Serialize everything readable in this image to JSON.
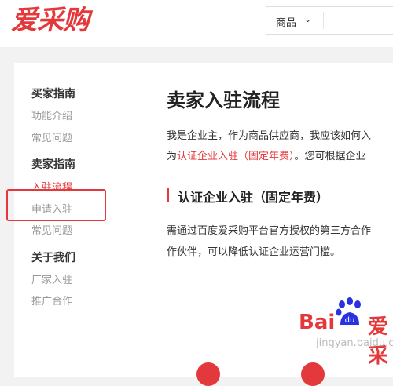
{
  "header": {
    "logo": "爱采购",
    "search_category": "商品",
    "chevron_glyph": "⌄"
  },
  "sidebar": {
    "groups": [
      {
        "title": "买家指南",
        "items": [
          "功能介绍",
          "常见问题"
        ]
      },
      {
        "title": "卖家指南",
        "items": [
          "入驻流程",
          "申请入驻",
          "常见问题"
        ]
      },
      {
        "title": "关于我们",
        "items": [
          "厂家入驻",
          "推广合作"
        ]
      }
    ],
    "active_item": "入驻流程"
  },
  "main": {
    "title": "卖家入驻流程",
    "intro_line1": "我是企业主，作为商品供应商，我应该如何入",
    "intro_line2_prefix": "为",
    "intro_line2_link": "认证企业入驻（固定年费）",
    "intro_line2_suffix": "。您可根据企业",
    "section_title": "认证企业入驻（固定年费）",
    "section_line1": "需通过百度爱采购平台官方授权的第三方合作",
    "section_line2": "作伙伴，可以降低认证企业运营门槛。"
  },
  "watermark": {
    "brand_left": "Bai",
    "paw_text": "du",
    "brand_right": "爱采",
    "subtext": "jingyan.baidu.com"
  },
  "colors": {
    "accent": "#e4393c"
  }
}
